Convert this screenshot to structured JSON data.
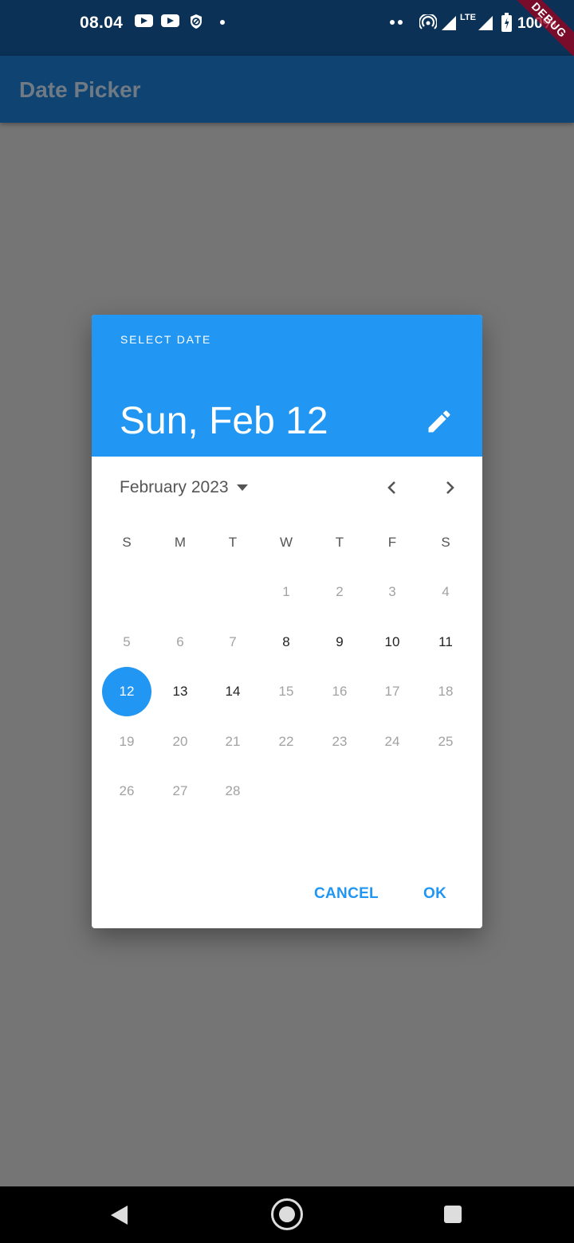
{
  "status_bar": {
    "time": "08.04",
    "battery": "100%",
    "network": "LTE",
    "debug_label": "DEBUG",
    "icons": [
      "youtube-icon",
      "youtube-icon",
      "vpn-shield-icon",
      "notification-dot-icon",
      "hotspot-icon",
      "signal-icon",
      "signal-icon",
      "battery-charging-icon"
    ]
  },
  "app_bar": {
    "title": "Date Picker"
  },
  "dialog": {
    "help_text": "SELECT DATE",
    "selected_date": "Sun, Feb 12",
    "month_year": "February 2023",
    "weekdays": [
      "S",
      "M",
      "T",
      "W",
      "T",
      "F",
      "S"
    ],
    "weeks": [
      [
        "",
        "",
        "",
        "1",
        "2",
        "3",
        "4"
      ],
      [
        "5",
        "6",
        "7",
        "8",
        "9",
        "10",
        "11"
      ],
      [
        "12",
        "13",
        "14",
        "15",
        "16",
        "17",
        "18"
      ],
      [
        "19",
        "20",
        "21",
        "22",
        "23",
        "24",
        "25"
      ],
      [
        "26",
        "27",
        "28",
        "",
        "",
        "",
        ""
      ]
    ],
    "selected_day": "12",
    "enabled_days": [
      "8",
      "9",
      "10",
      "11",
      "12",
      "13",
      "14"
    ],
    "cancel_label": "CANCEL",
    "ok_label": "OK"
  },
  "colors": {
    "primary": "#2196f3",
    "app_bar": "#0f4371",
    "status_bar": "#0b3156",
    "scrim_background": "#757575",
    "disabled_day": "#a2a2a2"
  }
}
